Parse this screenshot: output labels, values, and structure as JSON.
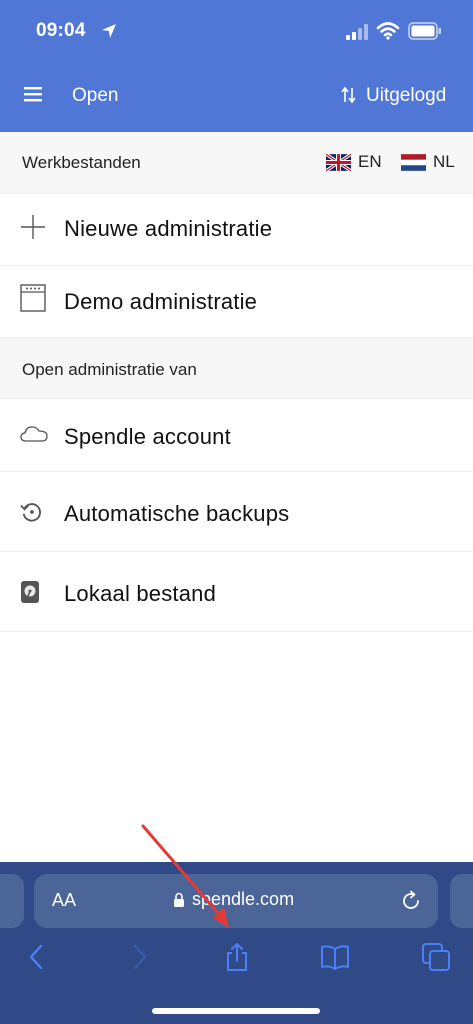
{
  "status_bar": {
    "time": "09:04"
  },
  "header": {
    "title": "Open",
    "login_status": "Uitgelogd"
  },
  "werkbestanden": {
    "title": "Werkbestanden",
    "languages": [
      {
        "code": "EN"
      },
      {
        "code": "NL"
      }
    ],
    "items": [
      {
        "label": "Nieuwe administratie",
        "icon": "plus-icon"
      },
      {
        "label": "Demo administratie",
        "icon": "calendar-window-icon"
      }
    ]
  },
  "open_van": {
    "title": "Open administratie van",
    "items": [
      {
        "label": "Spendle account",
        "icon": "cloud-icon"
      },
      {
        "label": "Automatische backups",
        "icon": "history-icon"
      },
      {
        "label": "Lokaal bestand",
        "icon": "harddisk-icon"
      }
    ]
  },
  "browser": {
    "text_size_label": "AA",
    "url": "spendle.com",
    "toolbar": [
      "back-icon",
      "forward-icon",
      "share-icon",
      "bookmarks-icon",
      "tabs-icon"
    ]
  },
  "colors": {
    "header": "#5177d6",
    "safari_bar": "#2f4a86",
    "address_field": "#4b6599",
    "toolbar_icon": "#4a7ff5",
    "annotation_arrow": "#e53935"
  }
}
